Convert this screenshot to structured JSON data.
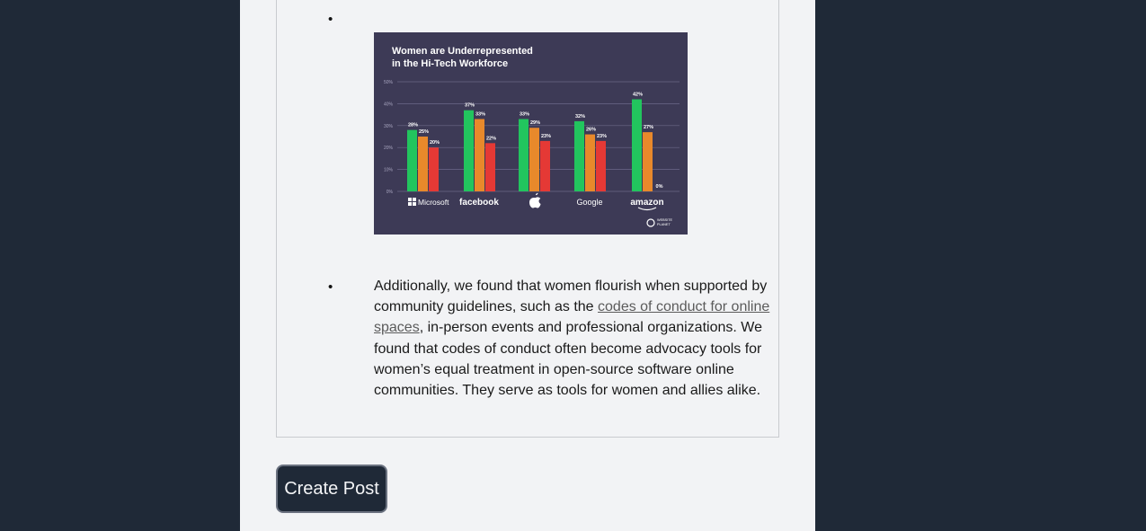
{
  "post": {
    "bullet_char": "•",
    "paragraph_before_link": "Additionally, we found that women flourish when supported by community guidelines, such as the ",
    "link_text": "codes of conduct for online spaces",
    "paragraph_after_link": ", in-person events and professional organizations. We found that codes of conduct often become advocacy tools for women’s equal treatment in open-source software online communities. They serve as tools for women and allies alike."
  },
  "create_post_label": "Create Post",
  "chart_data": {
    "type": "bar",
    "title_line1": "Women are Underrepresented",
    "title_line2": "in the Hi-Tech Workforce",
    "categories": [
      "Microsoft",
      "facebook",
      "",
      "Google",
      "amazon"
    ],
    "category_icons": [
      "windows-logo-icon",
      null,
      "apple-logo-icon",
      null,
      null
    ],
    "series": [
      {
        "color": "#22c55e",
        "values": [
          28,
          37,
          33,
          32,
          42
        ]
      },
      {
        "color": "#e8892b",
        "values": [
          25,
          33,
          29,
          26,
          27
        ]
      },
      {
        "color": "#e53935",
        "values": [
          20,
          22,
          23,
          23,
          0
        ]
      }
    ],
    "data_labels": [
      [
        "28%",
        "25%",
        "20%"
      ],
      [
        "37%",
        "33%",
        "22%"
      ],
      [
        "33%",
        "29%",
        "23%"
      ],
      [
        "32%",
        "26%",
        "23%"
      ],
      [
        "42%",
        "27%",
        "0%"
      ]
    ],
    "yticks": [
      "0%",
      "10%",
      "20%",
      "30%",
      "40%",
      "50%"
    ],
    "ylim": [
      0,
      50
    ],
    "grid": true,
    "background": "#3d3a56",
    "watermark": "WEBSITE PLANET"
  }
}
